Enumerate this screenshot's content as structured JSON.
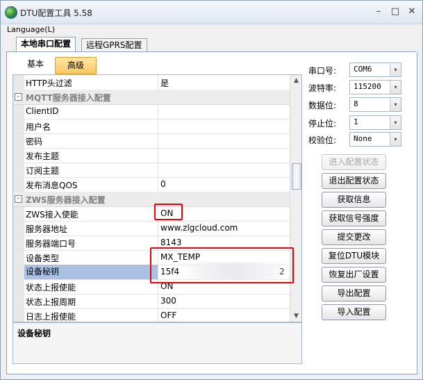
{
  "window": {
    "title": "DTU配置工具 5.58",
    "min": "–",
    "max": "□",
    "close": "✕"
  },
  "menu": {
    "language": "Language(L)"
  },
  "tabs": [
    {
      "label": "本地串口配置"
    },
    {
      "label": "远程GPRS配置"
    }
  ],
  "subtabs": {
    "basic": "基本",
    "advanced": "高级"
  },
  "grid": {
    "rows": [
      {
        "type": "prop",
        "name": "HTTP头过滤",
        "value": "是"
      },
      {
        "type": "cat",
        "name": "MQTT服务器接入配置"
      },
      {
        "type": "prop",
        "name": "ClientID",
        "value": ""
      },
      {
        "type": "prop",
        "name": "用户名",
        "value": ""
      },
      {
        "type": "prop",
        "name": "密码",
        "value": ""
      },
      {
        "type": "prop",
        "name": "发布主题",
        "value": ""
      },
      {
        "type": "prop",
        "name": "订阅主题",
        "value": ""
      },
      {
        "type": "prop",
        "name": "发布消息QOS",
        "value": "0"
      },
      {
        "type": "cat",
        "name": "ZWS服务器接入配置"
      },
      {
        "type": "prop",
        "name": "ZWS接入使能",
        "value": "ON"
      },
      {
        "type": "prop",
        "name": "服务器地址",
        "value": "www.zlgcloud.com"
      },
      {
        "type": "prop",
        "name": "服务器端口号",
        "value": "8143"
      },
      {
        "type": "prop",
        "name": "设备类型",
        "value": "MX_TEMP"
      },
      {
        "type": "prop",
        "name": "设备秘钥",
        "value": "15f4",
        "value_tail": "2"
      },
      {
        "type": "prop",
        "name": "状态上报使能",
        "value": "ON"
      },
      {
        "type": "prop",
        "name": "状态上报周期",
        "value": "300"
      },
      {
        "type": "prop",
        "name": "日志上报使能",
        "value": "OFF"
      }
    ],
    "collapse_glyph": "–"
  },
  "description": {
    "title": "设备秘钥"
  },
  "serial": [
    {
      "label": "串口号:",
      "value": "COM6"
    },
    {
      "label": "波特率:",
      "value": "115200"
    },
    {
      "label": "数据位:",
      "value": "8"
    },
    {
      "label": "停止位:",
      "value": "1"
    },
    {
      "label": "校验位:",
      "value": "None"
    }
  ],
  "buttons": [
    {
      "label": "进入配置状态",
      "enabled": false
    },
    {
      "label": "退出配置状态",
      "enabled": true
    },
    {
      "label": "获取信息",
      "enabled": true
    },
    {
      "label": "获取信号强度",
      "enabled": true
    },
    {
      "label": "提交更改",
      "enabled": true
    },
    {
      "label": "复位DTU模块",
      "enabled": true
    },
    {
      "label": "恢复出厂设置",
      "enabled": true
    },
    {
      "label": "导出配置",
      "enabled": true
    },
    {
      "label": "导入配置",
      "enabled": true
    }
  ],
  "colors": {
    "highlight_box": "#e8000b",
    "selected_row": "#a9c1e3",
    "advanced_tab": "#fbc862"
  }
}
